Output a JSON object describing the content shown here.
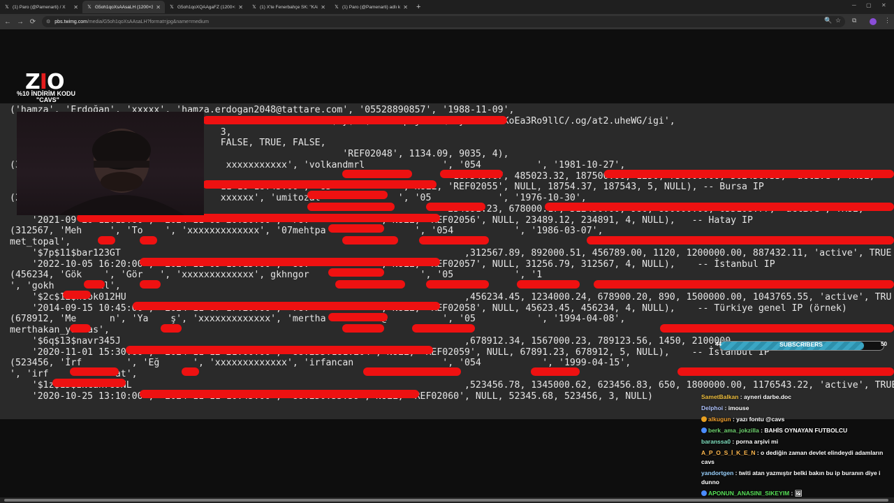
{
  "tabs": [
    {
      "label": "(1) Paro (@Pamenarti) / X",
      "icon": "x-logo-icon"
    },
    {
      "label": "G5oh1qoXsAAsaLH (1200×354)",
      "icon": "x-logo-icon"
    },
    {
      "label": "G5oh1qoXQAAgaFZ (1200×311)",
      "icon": "x-logo-icon"
    },
    {
      "label": "(1) X'te Fenerbahçe SK: \"KAMU…",
      "icon": "x-logo-icon"
    },
    {
      "label": "(1) Paro (@Pamenarti) adlı kullan…",
      "icon": "x-logo-icon"
    }
  ],
  "address": {
    "host": "pbs.twimg.com",
    "path": "/media/G5oh1qoXsAAsaLH?format=jpg&name=medium"
  },
  "logo": {
    "brand": "ZIO",
    "line1": "%10 İNDİRİM KODU",
    "line2": "\"CAVS\""
  },
  "code_lines": [
    "('hamza', 'Erdoğan', 'xxxxx', 'hamza.erdogan2048@tattare.com', '05528890857', '1988-11-09',",
    "                                                          $2y$10$92IXUNpkj00rOQ5byMi.Ye4oKoEa3Ro9llC/.og/at2.uheWG/igi',",
    "                                      3,",
    "                                      FALSE, TRUE, FALSE,",
    "                                                            'REF02048', 1134.09, 9035, 4),",
    "(3                                     xxxxxxxxxxx', 'volkandmrl              ', '054          ', '1981-10-27',",
    "                                                                                187543.67, 485023.32, 187500.00, 1250, 750000.00, 562456.33, 'active', TRUE,",
    "                                      11-10 18:45:00', '85            ', NULL, 'REF02055', NULL, 18754.37, 187543, 5, NULL), -- Bursa IP",
    "(2                                    xxxxxx', 'umitozat              ', '05            ', '1976-10-30',",
    "    $5b$14$qwe                                                                 234891.23, 678000.17, 312450.00, 980, 890000.00, 655108.77, 'active', TRUE,",
    "    '2021-09-20 12:15:00', '2024-11-08 20:30:00', '78.            ', NULL, 'REF02056', NULL, 23489.12, 234891, 4, NULL),   -- Hatay IP",
    "(312567, 'Meh     ', 'To    ', 'xxxxxxxxxxxxx', '07mehtpa                ', '054           ', '1986-03-07',",
    "met_topal',",
    "    '$7p$11$bar123GT                                                              ,312567.89, 892000.51, 456789.00, 1120, 1200000.00, 887432.11, 'active', TRUE",
    "    '2022-10-05 16:20:00', '2024-11-09 19:15:00', '88.            ', NULL, 'REF02057', NULL, 31256.79, 312567, 4, NULL),    -- İstanbul IP",
    "(456234, 'Gök    ', 'Gör   ', 'xxxxxxxxxxxxx', gkhngor                    ', '05           ', '1",
    "', 'gokh       nul',",
    "    '$2c$12$hook012HU                                                             ,456234.45, 1234000.24, 678900.20, 890, 1500000.00, 1043765.55, 'active', TRU",
    "    '2014-09-15 10:45:00', '2024-11-07 17:20:00', '78.            ', NULL, 'REF02058', NULL, 45623.45, 456234, 4, NULL),    -- Türkiye genel IP (örnek)",
    "(678912, 'Me      n', 'Ya    ş', 'xxxxxxxxxxxxx', 'mertha        as@          ', '05           ', '1994-04-08',",
    "merthakan_yandas',",
    "    '$6q$13$navr345J                                                              ,678912.34, 1567000.23, 789123.56, 1450, 2100000",
    "    '2020-11-01 15:30:00', '2024-11-12 21:00:00', '88.255.181.204', NULL, 'REF02059', NULL, 67891.23, 678912, 5, NULL),    -- İstanbul IP",
    "(523456, 'İrf        ', 'Eğ      ', 'xxxxxxxxxxxxx', 'irfancan                ', '054           ', '1999-04-15',",
    "', 'irf            at',",
    "    '$1z$15$INcan789NL                                                            ,523456.78, 1345000.62, 623456.83, 650, 1800000.00, 1176543.22, 'active', TRUE,",
    "    '2020-10-25 13:10:00', '2024-11-11 16:45:00', '88.250.55.59', NULL, 'REF02060', NULL, 52345.68, 523456, 3, NULL)"
  ],
  "sub_goal": {
    "current": "44",
    "label": "SUBSCRIBERS",
    "goal": "50",
    "progress": 0.88
  },
  "chat": [
    {
      "user": "SametBalkan",
      "user_color": "#f0c040",
      "text": ": ayneri darbe.doc"
    },
    {
      "user": "Delphoi",
      "user_color": "#b0c4ff",
      "text": ": imouse"
    },
    {
      "user": "alkugun",
      "user_color": "#f0a030",
      "text": ": yazı fontu @cavs",
      "badge": "#e8a020"
    },
    {
      "user": "berk_ama_jokzilla",
      "user_color": "#6fd36f",
      "text": ": BAHİS OYNAYAN FUTBOLCU",
      "badge": "#4a8cff"
    },
    {
      "user": "baranssa0",
      "user_color": "#7fe0c0",
      "text": ": porna arşivi mi"
    },
    {
      "user": "A_P_O_S_İ_K_E_N",
      "user_color": "#ffb84d",
      "text": ": o dediğin zaman devlet elindeydi adamların cavs"
    },
    {
      "user": "yandortgen",
      "user_color": "#9bd3ff",
      "text": ": twiti atan yazmıştır belki bakın bu ip buranın diye i dunno"
    },
    {
      "user": "APONUN_ANASINI_SIKEYIM",
      "user_color": "#57e057",
      "text": ": 🖼",
      "badge": "#4a8cff"
    }
  ],
  "colors": {
    "redact": "#ee1111",
    "accent_purple": "#8a4dd8"
  }
}
